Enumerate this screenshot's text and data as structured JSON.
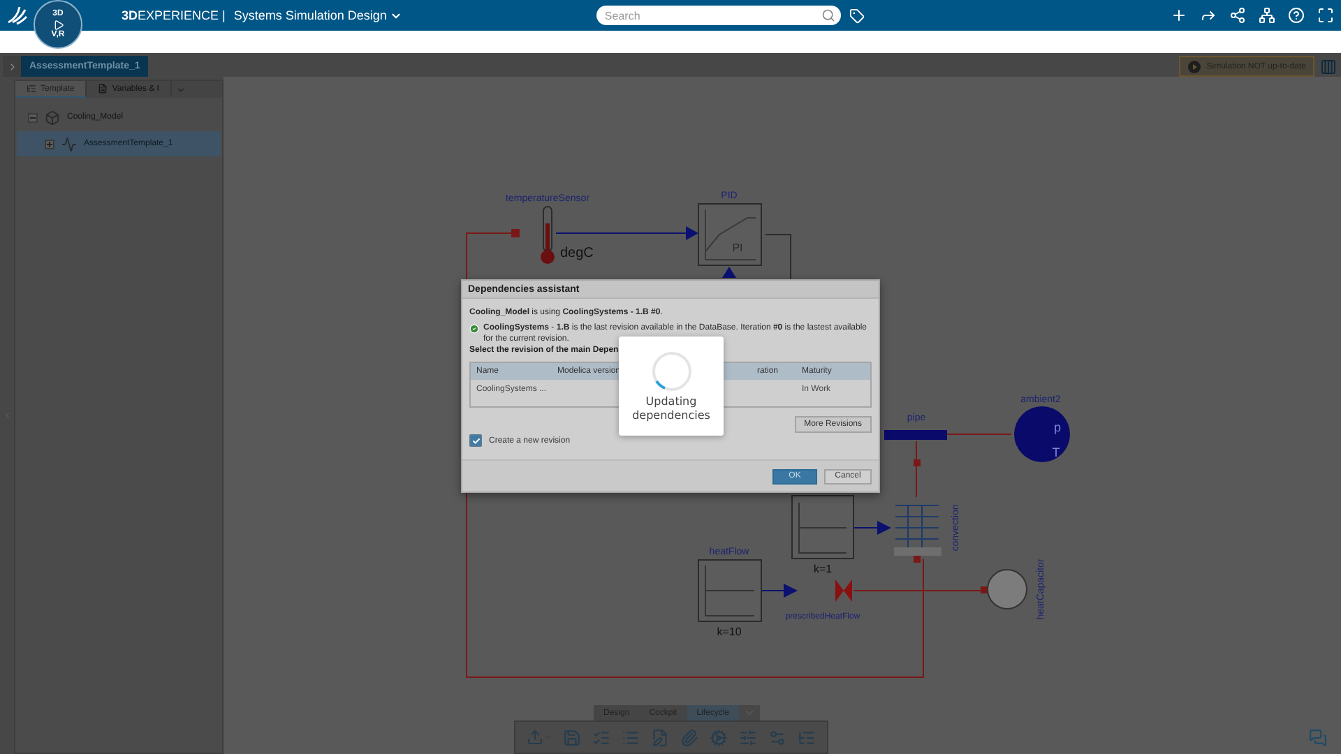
{
  "header": {
    "compass": [
      "3D",
      "V,R"
    ],
    "brand": "**3D**EXPERIENCE |",
    "app": "Systems Simulation Design",
    "search": {
      "placeholder": "Search"
    }
  },
  "workspace": {
    "tab": "AssessmentTemplate_1",
    "simulation_status": "Simulation NOT up-to-date"
  },
  "panel": {
    "tabs": [
      {
        "label": "Template",
        "selected": true
      },
      {
        "label": "Variables & I",
        "selected": false
      }
    ],
    "tree": [
      {
        "label": "Cooling_Model",
        "expanded": true,
        "selected": false,
        "children": [
          {
            "label": "AssessmentTemplate_1",
            "expanded": false,
            "selected": true
          }
        ]
      }
    ]
  },
  "diagram": {
    "labels": [
      {
        "text": "temperatureSensor",
        "kind": "name"
      },
      {
        "text": "degC",
        "kind": "unit"
      },
      {
        "text": "PID",
        "kind": "name"
      },
      {
        "text": "PI",
        "kind": "faint"
      },
      {
        "text": "pipe",
        "kind": "name"
      },
      {
        "text": "ambient2",
        "kind": "name"
      },
      {
        "text": "p",
        "kind": "inner"
      },
      {
        "text": "T",
        "kind": "inner"
      },
      {
        "text": "k=1",
        "kind": "param"
      },
      {
        "text": "convection",
        "kind": "vertical"
      },
      {
        "text": "heatFlow",
        "kind": "name"
      },
      {
        "text": "k=10",
        "kind": "param"
      },
      {
        "text": "prescribedHeatFlow",
        "kind": "small"
      },
      {
        "text": "heatCapacitor",
        "kind": "vertical"
      }
    ]
  },
  "dialog": {
    "title": "Dependencies assistant",
    "intro": "**Cooling_Model** is using **CoolingSystems - 1.B #0**.",
    "status": "**CoolingSystems** - **1.B** is the last revision available in the DataBase. Iteration **#0** is the lastest available for the current revision.",
    "prompt": "Select the revision of the main Depen",
    "table": {
      "columns": [
        "Name",
        "Modelica version",
        "ration",
        "Maturity"
      ],
      "rows": [
        [
          "CoolingSystems ...",
          "",
          "",
          "In Work"
        ]
      ]
    },
    "more_button": "More Revisions",
    "create_revision": {
      "label": "Create a new revision",
      "checked": true
    },
    "buttons": [
      "OK",
      "Cancel"
    ]
  },
  "progress": {
    "message": "Updating dependencies"
  },
  "bottom_tabs": [
    {
      "label": "Design",
      "selected": false
    },
    {
      "label": "Cockpit",
      "selected": false
    },
    {
      "label": "Lifecycle",
      "selected": true
    }
  ]
}
